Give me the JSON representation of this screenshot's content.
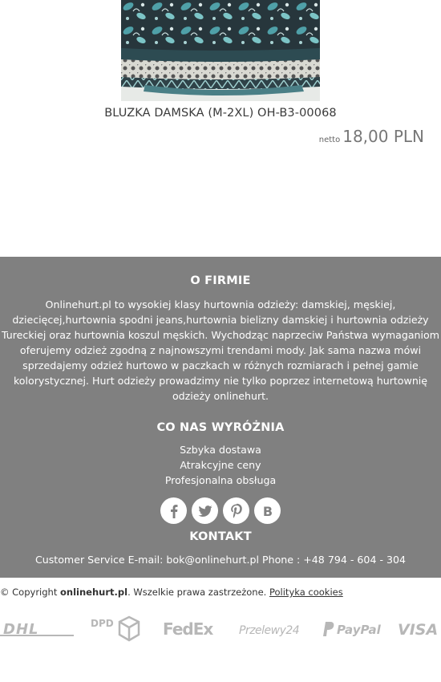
{
  "product": {
    "title": "BLUZKA DAMSKA (M-2XL) OH-B3-00068",
    "price_prefix": "netto",
    "price": "18,00 PLN"
  },
  "footer": {
    "about": {
      "title": "O FIRMIE",
      "text": "Onlinehurt.pl to wysokiej klasy hurtownia odzieży: damskiej, męskiej, dziecięcej,hurtownia spodni jeans,hurtownia bielizny damskiej i hurtownia odzieży Tureckiej oraz hurtownia koszul męskich. Wychodząc naprzeciw Państwa wymaganiom oferujemy odzież zgodną z najnowszymi trendami mody. Jak sama nazwa mówi sprzedajemy odzież hurtowo w paczkach w różnych rozmiarach i pełnej gamie kolorystycznej. Hurt odzieży prowadzimy nie tylko poprzez internetową hurtownię odzieży onlinehurt."
    },
    "features": {
      "title": "CO NAS WYRÓŻNIA",
      "items": [
        "Szbyka dostawa",
        "Atrakcyjne ceny",
        "Profesjonalna obsługa"
      ]
    },
    "social_icons": [
      "facebook-icon",
      "twitter-icon",
      "pinterest-icon",
      "blog-icon"
    ],
    "contact": {
      "title": "KONTAKT",
      "line": "Customer Service E-mail: bok@onlinehurt.pl Phone : +48 794 - 604 - 304"
    }
  },
  "bottom": {
    "copyright_prefix": "© Copyright ",
    "site": "onlinehurt.pl",
    "rights": ". Wszelkie prawa zastrzeżone. ",
    "cookies_link": "Polityka cookies",
    "logos": {
      "dhl": "DHL",
      "dpd": "DPD",
      "fedex": "FedEx",
      "przelewy": "Przelewy24",
      "paypal": "PayPal",
      "visa": "VISA"
    },
    "logo_color": "#b7b7b7"
  },
  "colors": {
    "footer_bg": "#808080",
    "text_dark": "#333333",
    "price": "#777777"
  }
}
